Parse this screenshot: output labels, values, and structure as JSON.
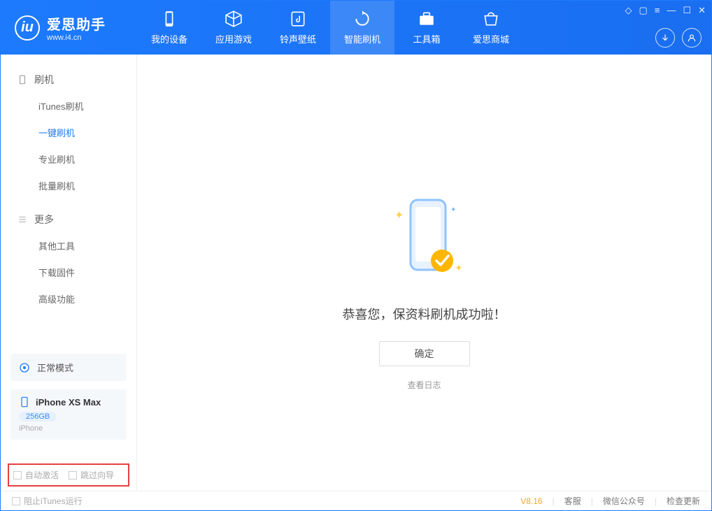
{
  "app": {
    "name": "爱思助手",
    "url": "www.i4.cn"
  },
  "tabs": {
    "t0": "我的设备",
    "t1": "应用游戏",
    "t2": "铃声壁纸",
    "t3": "智能刷机",
    "t4": "工具箱",
    "t5": "爱思商城"
  },
  "sidebar": {
    "group1": "刷机",
    "items1": {
      "i0": "iTunes刷机",
      "i1": "一键刷机",
      "i2": "专业刷机",
      "i3": "批量刷机"
    },
    "group2": "更多",
    "items2": {
      "i0": "其他工具",
      "i1": "下载固件",
      "i2": "高级功能"
    },
    "status": "正常模式",
    "device": {
      "name": "iPhone XS Max",
      "capacity": "256GB",
      "type": "iPhone"
    },
    "checks": {
      "c0": "自动激活",
      "c1": "跳过向导"
    }
  },
  "main": {
    "message": "恭喜您，保资料刷机成功啦！",
    "ok": "确定",
    "log": "查看日志"
  },
  "footer": {
    "block": "阻止iTunes运行",
    "version": "V8.16",
    "links": {
      "l0": "客服",
      "l1": "微信公众号",
      "l2": "检查更新"
    }
  }
}
